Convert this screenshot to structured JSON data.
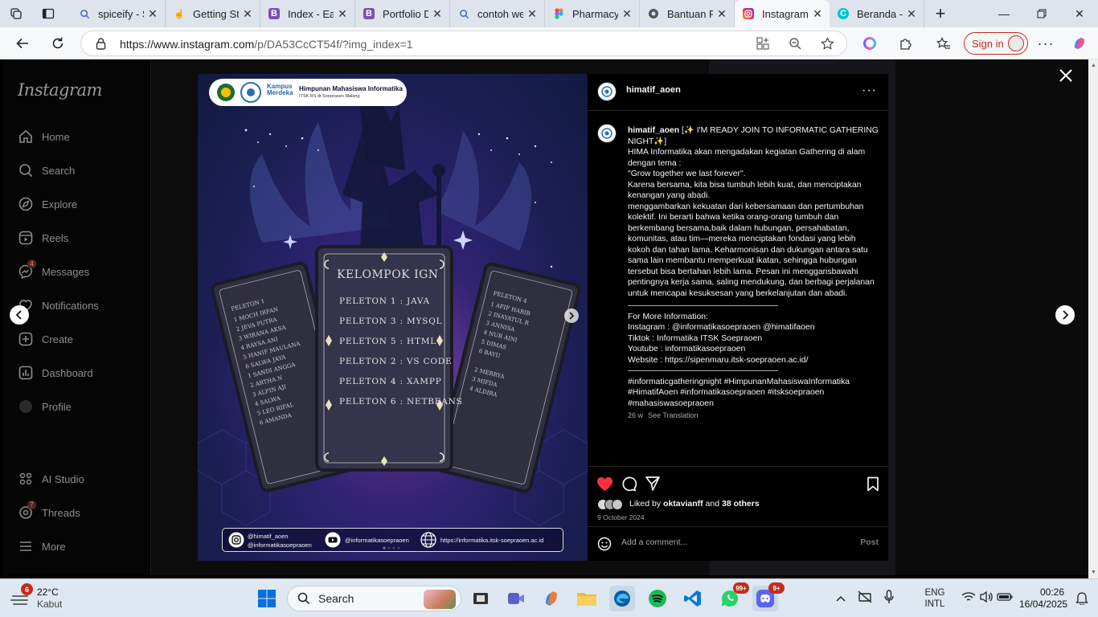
{
  "tabs": [
    {
      "title": "spiceify - S",
      "icon": "search-icon",
      "active": false
    },
    {
      "title": "Getting Sta",
      "icon": "hand-icon",
      "active": false
    },
    {
      "title": "Index - Ea",
      "icon": "bootstrap-icon",
      "active": false
    },
    {
      "title": "Portfolio D",
      "icon": "bootstrap-icon",
      "active": false
    },
    {
      "title": "contoh we",
      "icon": "search-icon",
      "active": false
    },
    {
      "title": "Pharmacy_",
      "icon": "figma-icon",
      "active": false
    },
    {
      "title": "Bantuan Pe",
      "icon": "settings-icon",
      "active": false
    },
    {
      "title": "Instagram",
      "icon": "instagram-icon",
      "active": true
    },
    {
      "title": "Beranda -",
      "icon": "canva-icon",
      "active": false
    }
  ],
  "address": {
    "host": "https://www.instagram.com",
    "path": "/p/DA53CcCT54f/?img_index=1",
    "signin_label": "Sign in"
  },
  "sidebar": {
    "logo": "Instagram",
    "items": [
      {
        "label": "Home",
        "icon": "home-icon"
      },
      {
        "label": "Search",
        "icon": "search-icon"
      },
      {
        "label": "Explore",
        "icon": "compass-icon"
      },
      {
        "label": "Reels",
        "icon": "reels-icon"
      },
      {
        "label": "Messages",
        "icon": "messenger-icon",
        "badge": "4"
      },
      {
        "label": "Notifications",
        "icon": "heart-icon"
      },
      {
        "label": "Create",
        "icon": "plus-square-icon"
      },
      {
        "label": "Dashboard",
        "icon": "chart-icon"
      },
      {
        "label": "Profile",
        "icon": "avatar-icon"
      },
      {
        "label": "AI Studio",
        "icon": "ai-studio-icon"
      },
      {
        "label": "Threads",
        "icon": "threads-icon",
        "badge": "7"
      },
      {
        "label": "More",
        "icon": "menu-icon"
      }
    ]
  },
  "post_image": {
    "org_name": "Himpunan Mahasiswa Informatika",
    "org_sub": "ITSK RS dr.Soepraoen Malang",
    "kampus_label": "Kampus Merdeka",
    "card_title": "KELOMPOK IGN",
    "groups": [
      "PELETON 1 : JAVA",
      "PELETON 3 : MYSQL",
      "PELETON 5 : HTML",
      "PELETON 2 : VS CODE",
      "PELETON 4 : XAMPP",
      "PELETON 6 : NETBEANS"
    ],
    "footer_ig1": "@himatif_aoen",
    "footer_ig2": "@informatikasoepraoen",
    "footer_yt": "@informatikasoepraoen",
    "footer_web": "https://informatika.itsk-soepraoen.ac.id"
  },
  "post": {
    "author": "himatif_aoen",
    "caption_head": "[✨ I'M READY JOIN TO INFORMATIC GATHERING NIGHT✨]",
    "caption_body": "HIMA Informatika akan mengadakan kegiatan Gathering di alam dengan tema :\n\"Grow together we last forever\".\nKarena bersama, kita bisa tumbuh lebih kuat, dan menciptakan kenangan yang abadi.\nmenggambarkan kekuatan dari kebersamaan dan pertumbuhan kolektif. Ini berarti bahwa ketika orang-orang tumbuh dan berkembang bersama,baik dalam hubungan, persahabatan, komunitas, atau tim—mereka menciptakan fondasi yang lebih kokoh dan tahan lama. Keharmonisan dan dukungan antara satu sama lain membantu memperkuat ikatan, sehingga hubungan tersebut bisa bertahan lebih lama. Pesan ini menggarisbawahi pentingnya kerja sama, saling mendukung, dan berbagi perjalanan untuk mencapai kesuksesan yang berkelanjutan dan abadi.",
    "divider1": "——————————————————",
    "info": "For More Information:\nInstagram : @informatikasoepraoen @himatifaoen\nTiktok : Informatika ITSK Soepraoen\nYoutube : informatikasoepraoen\nWebsite : https://sipenmaru.itsk-soepraoen.ac.id/",
    "divider2": "——————————————————",
    "hashtags": "#informaticgatheringnight #HimpunanMahasiswaInformatika #HimatifAoen #informatikasoepraoen #itsksoepraoen #mahasiswasoepraoen",
    "age": "26 w",
    "see_translation": "See Translation",
    "liked_by_prefix": "Liked by",
    "liked_by_user": "oktavianff",
    "liked_by_suffix": "and",
    "liked_by_others": "38 others",
    "date": "9 October 2024",
    "comment_placeholder": "Add a comment...",
    "post_button": "Post"
  },
  "taskbar": {
    "weather_temp": "22°C",
    "weather_desc": "Kabut",
    "weather_badge": "6",
    "search_label": "Search",
    "whatsapp_badge": "99+",
    "discord_badge": "9+",
    "lang1": "ENG",
    "lang2": "INTL",
    "time": "00:26",
    "date": "16/04/2025"
  },
  "colors": {
    "like": "#ff3040",
    "accent_edge": "#0c59a4",
    "signin": "#c42b1c"
  }
}
